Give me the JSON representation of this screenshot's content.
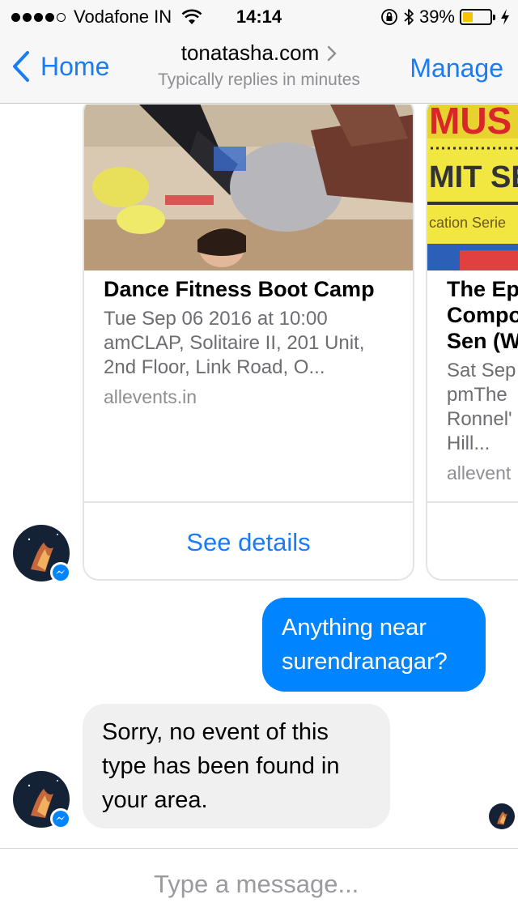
{
  "status_bar": {
    "carrier": "Vodafone IN",
    "time": "14:14",
    "battery_percent": "39%",
    "battery_level": 0.39,
    "signal_bars": 4,
    "signal_total": 5
  },
  "nav": {
    "back_label": "Home",
    "title": "tonatasha.com",
    "subtitle": "Typically replies in minutes",
    "manage_label": "Manage"
  },
  "cards": [
    {
      "title": "Dance Fitness Boot Camp",
      "description": "Tue Sep 06 2016 at 10:00 amCLAP, Solitaire II, 201 Unit, 2nd Floor, Link Road, O...",
      "desc_lines": [
        "Tue Sep 06 2016 at 10:00",
        "amCLAP, Solitaire II, 201 Unit,",
        "2nd Floor, Link Road, O..."
      ],
      "source": "allevents.in",
      "button_label": "See details"
    },
    {
      "title_lines": [
        "The Ep",
        "Compo",
        "Sen (W"
      ],
      "desc_lines": [
        "Sat Sep",
        "pmThe",
        "Ronnel'",
        "Hill..."
      ],
      "source": "allevent",
      "image_text": [
        "MUS",
        "MIT SE",
        "cation Serie"
      ]
    }
  ],
  "messages": [
    {
      "from": "user",
      "lines": [
        "Anything near",
        "surendranagar?"
      ]
    },
    {
      "from": "page",
      "lines": [
        "Sorry, no event of this",
        "type has been found in",
        "your area."
      ]
    }
  ],
  "composer": {
    "placeholder": "Type a message..."
  },
  "colors": {
    "accent": "#1a7cf5",
    "outgoing_bubble": "#0084ff",
    "incoming_bubble": "#f0f0f0",
    "battery_fill": "#f5c400"
  }
}
